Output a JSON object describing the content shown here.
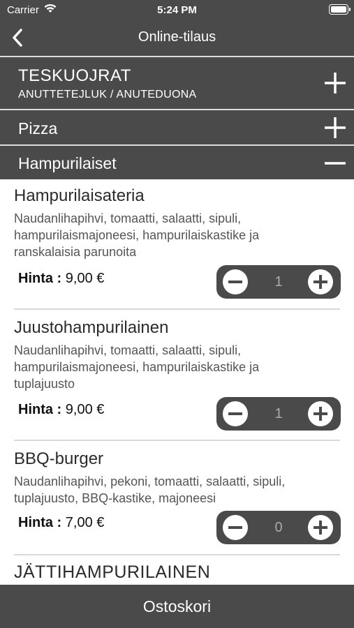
{
  "status": {
    "carrier": "Carrier",
    "time": "5:24 PM"
  },
  "nav": {
    "title": "Online-tilaus"
  },
  "sections": [
    {
      "title": "TESKUOJRAT",
      "subtitle": "ANUTTETEJLUK / ANUTEDUONA",
      "state": "collapsed",
      "icon": "plus-icon"
    },
    {
      "title": "Pizza",
      "state": "collapsed",
      "icon": "plus-icon"
    },
    {
      "title": "Hampurilaiset",
      "state": "expanded",
      "icon": "minus-icon"
    }
  ],
  "products": [
    {
      "name": "Hampurilaisateria",
      "desc": [
        "Naudanlihapihvi, tomaatti, salaatti, sipuli,",
        "hampurilaismajoneesi, hampurilaiskastike ja",
        "ranskalaisia parunoita"
      ],
      "price_label": "Hinta :",
      "price": "9,00 €",
      "qty": "1"
    },
    {
      "name": "Juustohampurilainen",
      "desc": [
        "Naudanlihapihvi, tomaatti, salaatti, sipuli,",
        "hampurilaismajoneesi, hampurilaiskastike ja",
        "tuplajuusto"
      ],
      "price_label": "Hinta :",
      "price": "9,00 €",
      "qty": "1"
    },
    {
      "name": "BBQ-burger",
      "desc": [
        "Naudanlihapihvi, pekoni, tomaatti, salaatti, sipuli,",
        "tuplajuusto, BBQ-kastike, majoneesi"
      ],
      "price_label": "Hinta :",
      "price": "7,00 €",
      "qty": "0"
    }
  ],
  "next_product": {
    "name": "JÄTTIHAMPURILAINEN"
  },
  "cart": {
    "label": "Ostoskori"
  },
  "colors": {
    "bar": "#4a4a4a",
    "divider": "#d9d9d9",
    "text": "#2b2b2b"
  }
}
